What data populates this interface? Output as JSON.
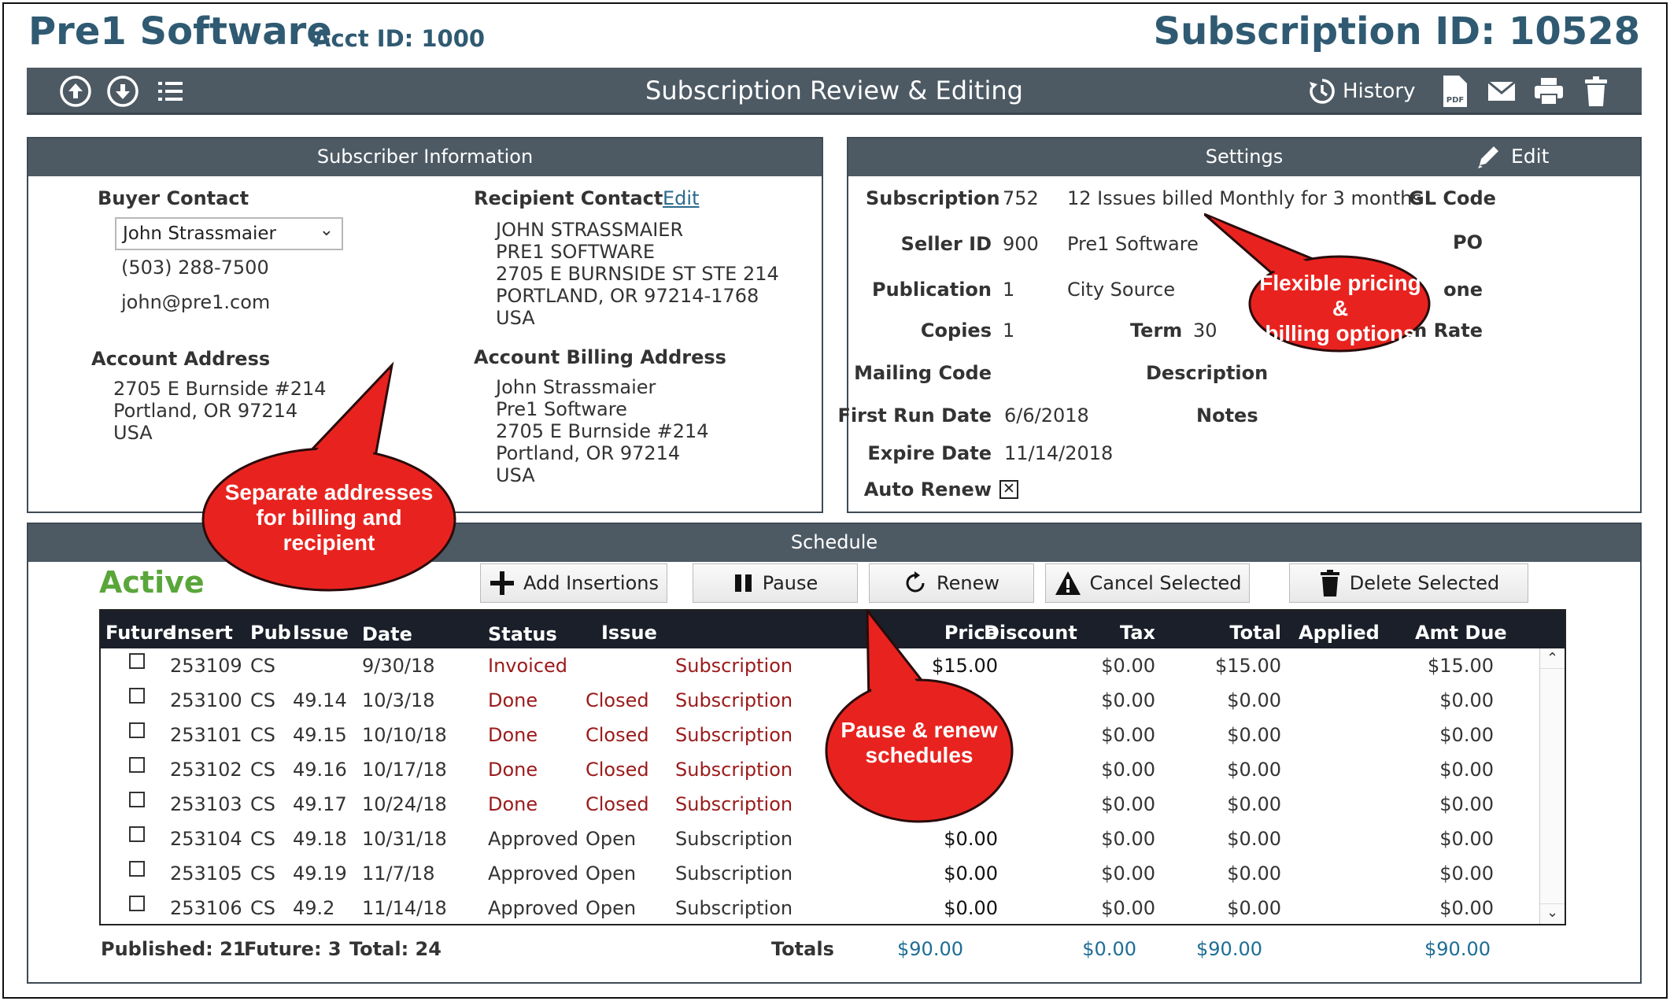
{
  "header": {
    "app_title": "Pre1 Software",
    "acct_id": "Acct ID: 1000",
    "subscription_id": "Subscription ID: 10528"
  },
  "toolbar": {
    "title": "Subscription Review & Editing",
    "history_label": "History",
    "icons": [
      "up-circle-icon",
      "down-circle-icon",
      "list-icon",
      "history-icon",
      "pdf-icon",
      "mail-icon",
      "print-icon",
      "trash-icon"
    ]
  },
  "subscriber": {
    "title": "Subscriber Information",
    "buyer_label": "Buyer Contact",
    "buyer_selected": "John Strassmaier",
    "buyer_phone": "(503) 288-7500",
    "buyer_email": "john@pre1.com",
    "recipient_label": "Recipient Contact",
    "recipient_edit": "Edit",
    "recipient_lines": [
      "JOHN STRASSMAIER",
      "PRE1 SOFTWARE",
      "2705 E BURNSIDE ST STE 214",
      "PORTLAND,  OR  97214-1768",
      "USA"
    ],
    "account_address_label": "Account Address",
    "account_address_lines": [
      "2705 E Burnside #214",
      "Portland,  OR  97214",
      "USA"
    ],
    "billing_label": "Account Billing Address",
    "billing_lines": [
      "John Strassmaier",
      "Pre1 Software",
      "2705 E Burnside #214",
      "Portland,  OR  97214",
      "USA"
    ]
  },
  "settings": {
    "title": "Settings",
    "edit_label": "Edit",
    "subscription_label": "Subscription",
    "subscription_value": "752",
    "subscription_desc": "12 Issues billed Monthly for 3 months",
    "gl_code_label": "GL Code",
    "seller_label": "Seller ID",
    "seller_value": "900",
    "seller_name": "Pre1 Software",
    "po_label": "PO",
    "publication_label": "Publication",
    "publication_value": "1",
    "publication_name": "City Source",
    "zone_label": "one",
    "copies_label": "Copies",
    "copies_value": "1",
    "term_label": "Term",
    "term_value": "30",
    "rate_label": "m Rate",
    "mailing_label": "Mailing Code",
    "description_label": "Description",
    "first_run_label": "First Run Date",
    "first_run_value": "6/6/2018",
    "notes_label": "Notes",
    "expire_label": "Expire Date",
    "expire_value": "11/14/2018",
    "auto_renew_label": "Auto Renew",
    "auto_renew_mark": "✕"
  },
  "schedule": {
    "title": "Schedule",
    "status": "Active",
    "buttons": {
      "add": "Add Insertions",
      "pause": "Pause",
      "renew": "Renew",
      "cancel": "Cancel Selected",
      "delete": "Delete Selected"
    },
    "columns": [
      "Future",
      "Insert",
      "Pub",
      "Issue",
      "Date",
      "Status",
      "Issue",
      "Price",
      "Discount",
      "Tax",
      "Total",
      "Applied",
      "Amt Due"
    ],
    "rows": [
      {
        "insert": "253109",
        "pub": "CS",
        "issue": "",
        "date": "9/30/18",
        "status": "Invoiced",
        "issue_status": "",
        "type": "Subscription",
        "price": "$15.00",
        "tax": "$0.00",
        "total": "$15.00",
        "amt_due": "$15.00"
      },
      {
        "insert": "253100",
        "pub": "CS",
        "issue": "49.14",
        "date": "10/3/18",
        "status": "Done",
        "issue_status": "Closed",
        "type": "Subscription",
        "price": "",
        "tax": "$0.00",
        "total": "$0.00",
        "amt_due": "$0.00"
      },
      {
        "insert": "253101",
        "pub": "CS",
        "issue": "49.15",
        "date": "10/10/18",
        "status": "Done",
        "issue_status": "Closed",
        "type": "Subscription",
        "price": "",
        "tax": "$0.00",
        "total": "$0.00",
        "amt_due": "$0.00"
      },
      {
        "insert": "253102",
        "pub": "CS",
        "issue": "49.16",
        "date": "10/17/18",
        "status": "Done",
        "issue_status": "Closed",
        "type": "Subscription",
        "price": "",
        "tax": "$0.00",
        "total": "$0.00",
        "amt_due": "$0.00"
      },
      {
        "insert": "253103",
        "pub": "CS",
        "issue": "49.17",
        "date": "10/24/18",
        "status": "Done",
        "issue_status": "Closed",
        "type": "Subscription",
        "price": "",
        "tax": "$0.00",
        "total": "$0.00",
        "amt_due": "$0.00"
      },
      {
        "insert": "253104",
        "pub": "CS",
        "issue": "49.18",
        "date": "10/31/18",
        "status": "Approved",
        "issue_status": "Open",
        "type": "Subscription",
        "price": "$0.00",
        "tax": "$0.00",
        "total": "$0.00",
        "amt_due": "$0.00"
      },
      {
        "insert": "253105",
        "pub": "CS",
        "issue": "49.19",
        "date": "11/7/18",
        "status": "Approved",
        "issue_status": "Open",
        "type": "Subscription",
        "price": "$0.00",
        "tax": "$0.00",
        "total": "$0.00",
        "amt_due": "$0.00"
      },
      {
        "insert": "253106",
        "pub": "CS",
        "issue": "49.2",
        "date": "11/14/18",
        "status": "Approved",
        "issue_status": "Open",
        "type": "Subscription",
        "price": "$0.00",
        "tax": "$0.00",
        "total": "$0.00",
        "amt_due": "$0.00"
      }
    ],
    "summary": {
      "published": "Published: 21",
      "future": "Future: 3",
      "total": "Total: 24",
      "totals_label": "Totals",
      "price": "$90.00",
      "tax": "$0.00",
      "total_amt": "$90.00",
      "amt_due": "$90.00"
    }
  },
  "callouts": {
    "addresses": [
      "Separate addresses",
      "for billing and",
      "recipient"
    ],
    "pricing": [
      "Flexible pricing &",
      "billing options"
    ],
    "pause": [
      "Pause & renew",
      "schedules"
    ]
  },
  "colors": {
    "title_blue": "#2f5a72",
    "toolbar": "#4d5a64",
    "active_green": "#5aa63a",
    "done_red": "#9b1a1a",
    "totals_blue": "#1e6d95",
    "callout_red": "#e8231f"
  }
}
